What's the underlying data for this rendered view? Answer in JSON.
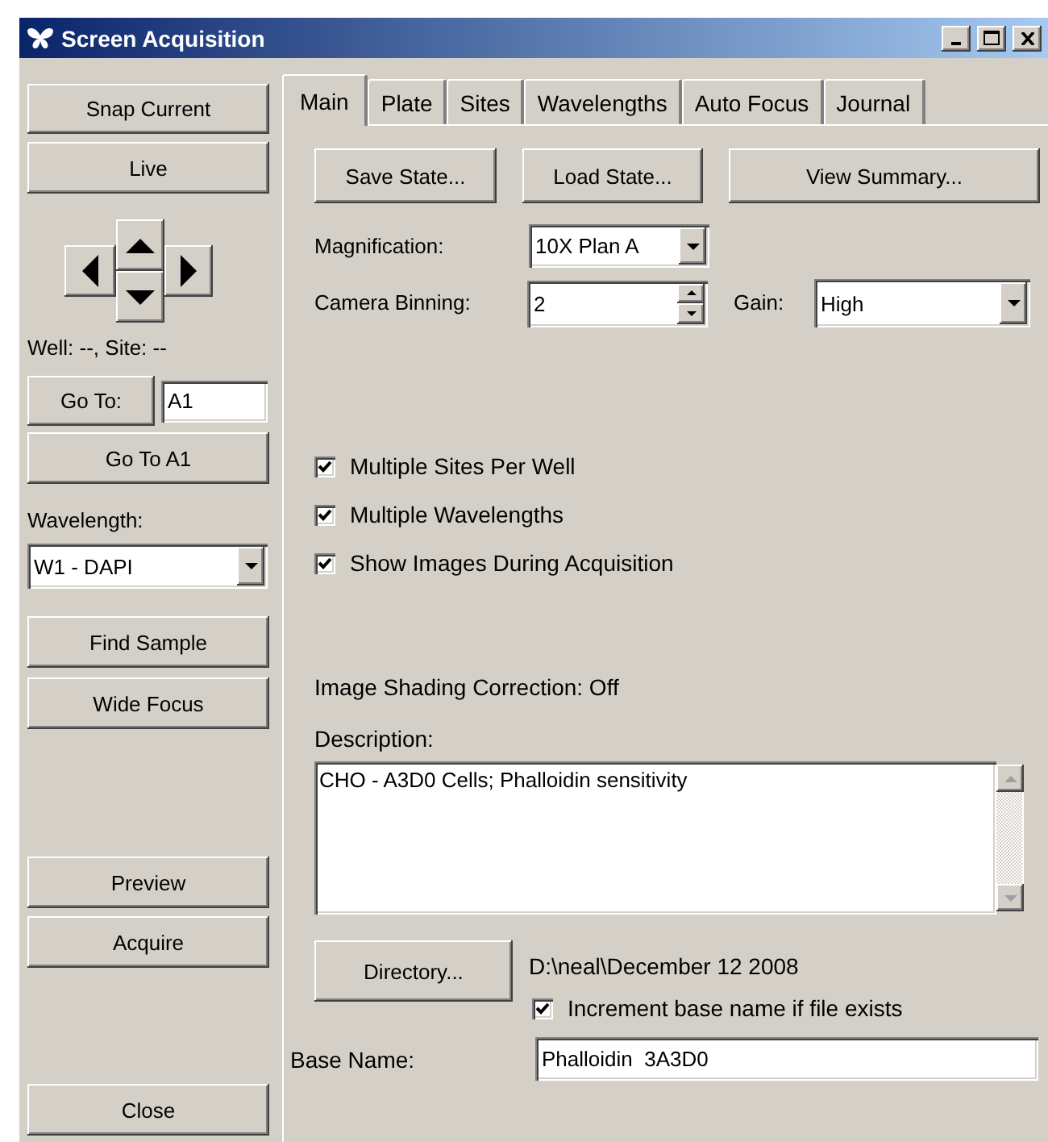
{
  "window": {
    "title": "Screen Acquisition"
  },
  "sidebar": {
    "snap": "Snap Current",
    "live": "Live",
    "position": "Well: --,  Site: --",
    "goto_button": "Go To:",
    "goto_value": "A1",
    "goto_a1": "Go To A1",
    "wavelength_label": "Wavelength:",
    "wavelength_value": "W1 - DAPI",
    "find_sample": "Find Sample",
    "wide_focus": "Wide Focus",
    "preview": "Preview",
    "acquire": "Acquire",
    "close": "Close"
  },
  "tabs": [
    {
      "label": "Main",
      "selected": true
    },
    {
      "label": "Plate",
      "selected": false
    },
    {
      "label": "Sites",
      "selected": false
    },
    {
      "label": "Wavelengths",
      "selected": false
    },
    {
      "label": "Auto Focus",
      "selected": false
    },
    {
      "label": "Journal",
      "selected": false
    }
  ],
  "main": {
    "buttons": [
      "Save State...",
      "Load State...",
      "View Summary..."
    ],
    "magnification_label": "Magnification:",
    "magnification_value": "10X Plan A",
    "binning_label": "Camera Binning:",
    "binning_value": "2",
    "gain_label": "Gain:",
    "gain_value": "High",
    "options": [
      {
        "label": "Multiple Sites Per Well",
        "checked": true
      },
      {
        "label": "Multiple Wavelengths",
        "checked": true
      },
      {
        "label": "Show Images During Acquisition",
        "checked": true
      }
    ],
    "shading": "Image Shading Correction: Off",
    "description_label": "Description:",
    "description": "CHO - A3D0 Cells; Phalloidin sensitivity",
    "directory_button": "Directory...",
    "directory_path": "D:\\neal\\December 12  2008",
    "increment": {
      "label": "Increment base name if file exists",
      "checked": true
    },
    "base_name_label": "Base Name:",
    "base_name": "Phalloidin  3A3D0"
  }
}
